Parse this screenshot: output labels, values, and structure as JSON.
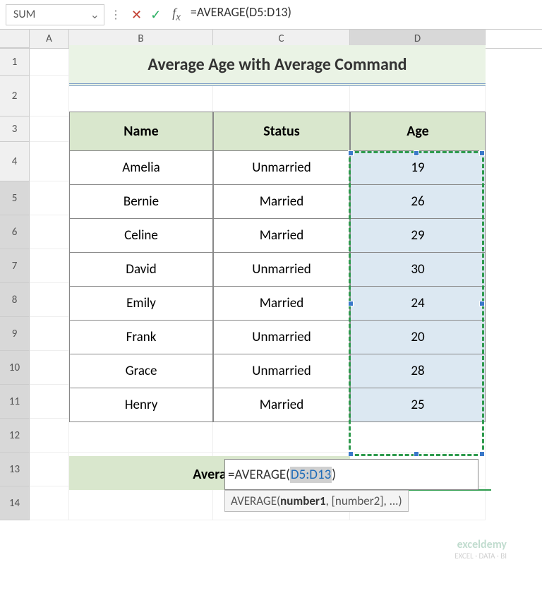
{
  "namebox": "SUM",
  "formula_display": "=AVERAGE(D5:D13)",
  "title": "Average Age with Average Command",
  "headers": {
    "name": "Name",
    "status": "Status",
    "age": "Age"
  },
  "rows": [
    {
      "name": "Amelia",
      "status": "Unmarried",
      "age": "19"
    },
    {
      "name": "Bernie",
      "status": "Married",
      "age": "26"
    },
    {
      "name": "Celine",
      "status": "Married",
      "age": "29"
    },
    {
      "name": "David",
      "status": "Unmarried",
      "age": "30"
    },
    {
      "name": "Emily",
      "status": "Married",
      "age": "24"
    },
    {
      "name": "Frank",
      "status": "Unmarried",
      "age": "20"
    },
    {
      "name": "Grace",
      "status": "Unmarried",
      "age": "28"
    },
    {
      "name": "Henry",
      "status": "Married",
      "age": "25"
    }
  ],
  "avg_label": "Avera",
  "editing_prefix": "=AVERAGE(",
  "editing_range": "D5:D13",
  "editing_suffix": ")",
  "tooltip_fn": "AVERAGE(",
  "tooltip_arg1": "number1",
  "tooltip_rest": ", [number2], ...)",
  "cols": {
    "A": "A",
    "B": "B",
    "C": "C",
    "D": "D"
  },
  "rownums": [
    "1",
    "2",
    "3",
    "4",
    "5",
    "6",
    "7",
    "8",
    "9",
    "10",
    "11",
    "12",
    "13",
    "14"
  ],
  "watermark": {
    "line1": "exceldemy",
    "line2": "EXCEL · DATA · BI"
  }
}
